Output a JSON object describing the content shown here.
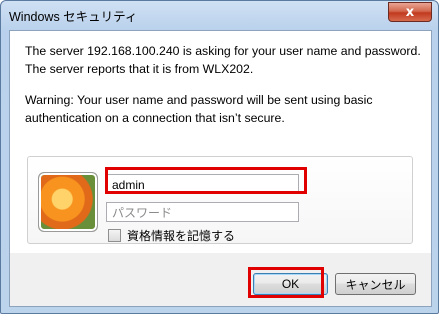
{
  "window": {
    "title": "Windows セキュリティ",
    "close_label": "x"
  },
  "message": {
    "line1": "The server 192.168.100.240 is asking for your user name and password. The server reports that it is from WLX202.",
    "line2": "Warning: Your user name and password will be sent using basic authentication on a connection that isn’t secure."
  },
  "credentials": {
    "username_value": "admin",
    "password_placeholder": "パスワード",
    "remember_label": "資格情報を記憶する",
    "remember_checked": false
  },
  "buttons": {
    "ok": "OK",
    "cancel": "キャンセル"
  },
  "highlight_color": "#e00000"
}
